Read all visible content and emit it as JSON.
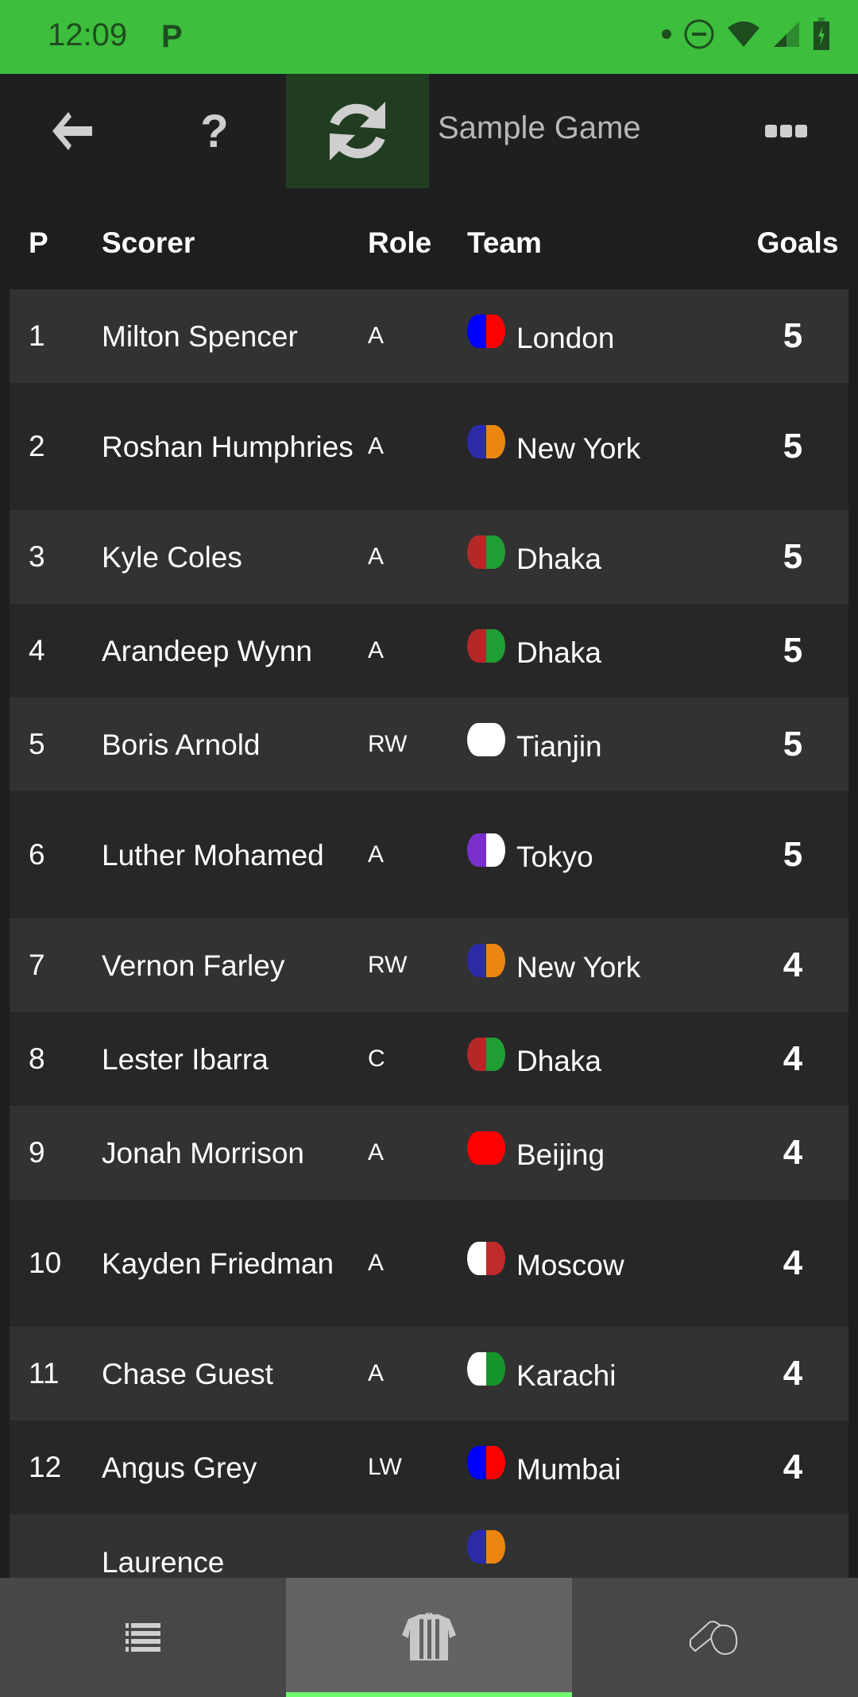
{
  "status_bar": {
    "time": "12:09",
    "app_indicator": "P",
    "icons": [
      "dot-icon",
      "do-not-disturb-icon",
      "wifi-icon",
      "signal-icon",
      "battery-charging-icon"
    ]
  },
  "toolbar": {
    "title": "Sample Game",
    "back_icon": "arrow-left-icon",
    "help_label": "?",
    "refresh_icon": "refresh-icon",
    "more_icon": "more-icon"
  },
  "table": {
    "headers": {
      "p": "P",
      "scorer": "Scorer",
      "role": "Role",
      "team": "Team",
      "goals": "Goals"
    },
    "rows": [
      {
        "p": "1",
        "scorer": "Milton Spencer",
        "role": "A",
        "team": "London",
        "goals": "5",
        "kit": [
          "#0000ff",
          "#ff0000"
        ]
      },
      {
        "p": "2",
        "scorer": "Roshan Humphries",
        "role": "A",
        "team": "New York",
        "goals": "5",
        "kit": [
          "#2b2ba6",
          "#ec860e"
        ]
      },
      {
        "p": "3",
        "scorer": "Kyle Coles",
        "role": "A",
        "team": "Dhaka",
        "goals": "5",
        "kit": [
          "#b52828",
          "#1f9e33"
        ]
      },
      {
        "p": "4",
        "scorer": "Arandeep Wynn",
        "role": "A",
        "team": "Dhaka",
        "goals": "5",
        "kit": [
          "#b52828",
          "#1f9e33"
        ]
      },
      {
        "p": "5",
        "scorer": "Boris Arnold",
        "role": "RW",
        "team": "Tianjin",
        "goals": "5",
        "kit": [
          "#ffffff",
          "#ffffff"
        ]
      },
      {
        "p": "6",
        "scorer": "Luther Mohamed",
        "role": "A",
        "team": "Tokyo",
        "goals": "5",
        "kit": [
          "#7a2fcc",
          "#ffffff"
        ]
      },
      {
        "p": "7",
        "scorer": "Vernon Farley",
        "role": "RW",
        "team": "New York",
        "goals": "4",
        "kit": [
          "#2b2ba6",
          "#ec860e"
        ]
      },
      {
        "p": "8",
        "scorer": "Lester Ibarra",
        "role": "C",
        "team": "Dhaka",
        "goals": "4",
        "kit": [
          "#b52828",
          "#1f9e33"
        ]
      },
      {
        "p": "9",
        "scorer": "Jonah Morrison",
        "role": "A",
        "team": "Beijing",
        "goals": "4",
        "kit": [
          "#ff0000",
          "#ff0000"
        ]
      },
      {
        "p": "10",
        "scorer": "Kayden Friedman",
        "role": "A",
        "team": "Moscow",
        "goals": "4",
        "kit": [
          "#ffffff",
          "#c02a2a"
        ]
      },
      {
        "p": "11",
        "scorer": "Chase Guest",
        "role": "A",
        "team": "Karachi",
        "goals": "4",
        "kit": [
          "#ffffff",
          "#15962a"
        ]
      },
      {
        "p": "12",
        "scorer": "Angus Grey",
        "role": "LW",
        "team": "Mumbai",
        "goals": "4",
        "kit": [
          "#0000ff",
          "#ff0000"
        ]
      },
      {
        "p": "",
        "scorer": "Laurence",
        "role": "",
        "team": "",
        "goals": "",
        "kit": [
          "#2b2ba6",
          "#ec860e"
        ]
      }
    ]
  },
  "bottom_nav": {
    "tabs": [
      {
        "name": "list",
        "icon": "list-icon",
        "active": false
      },
      {
        "name": "referee",
        "icon": "referee-shirt-icon",
        "active": true
      },
      {
        "name": "whistle",
        "icon": "whistle-icon",
        "active": false
      }
    ],
    "active_indicator_color": "#6dfa6d"
  }
}
